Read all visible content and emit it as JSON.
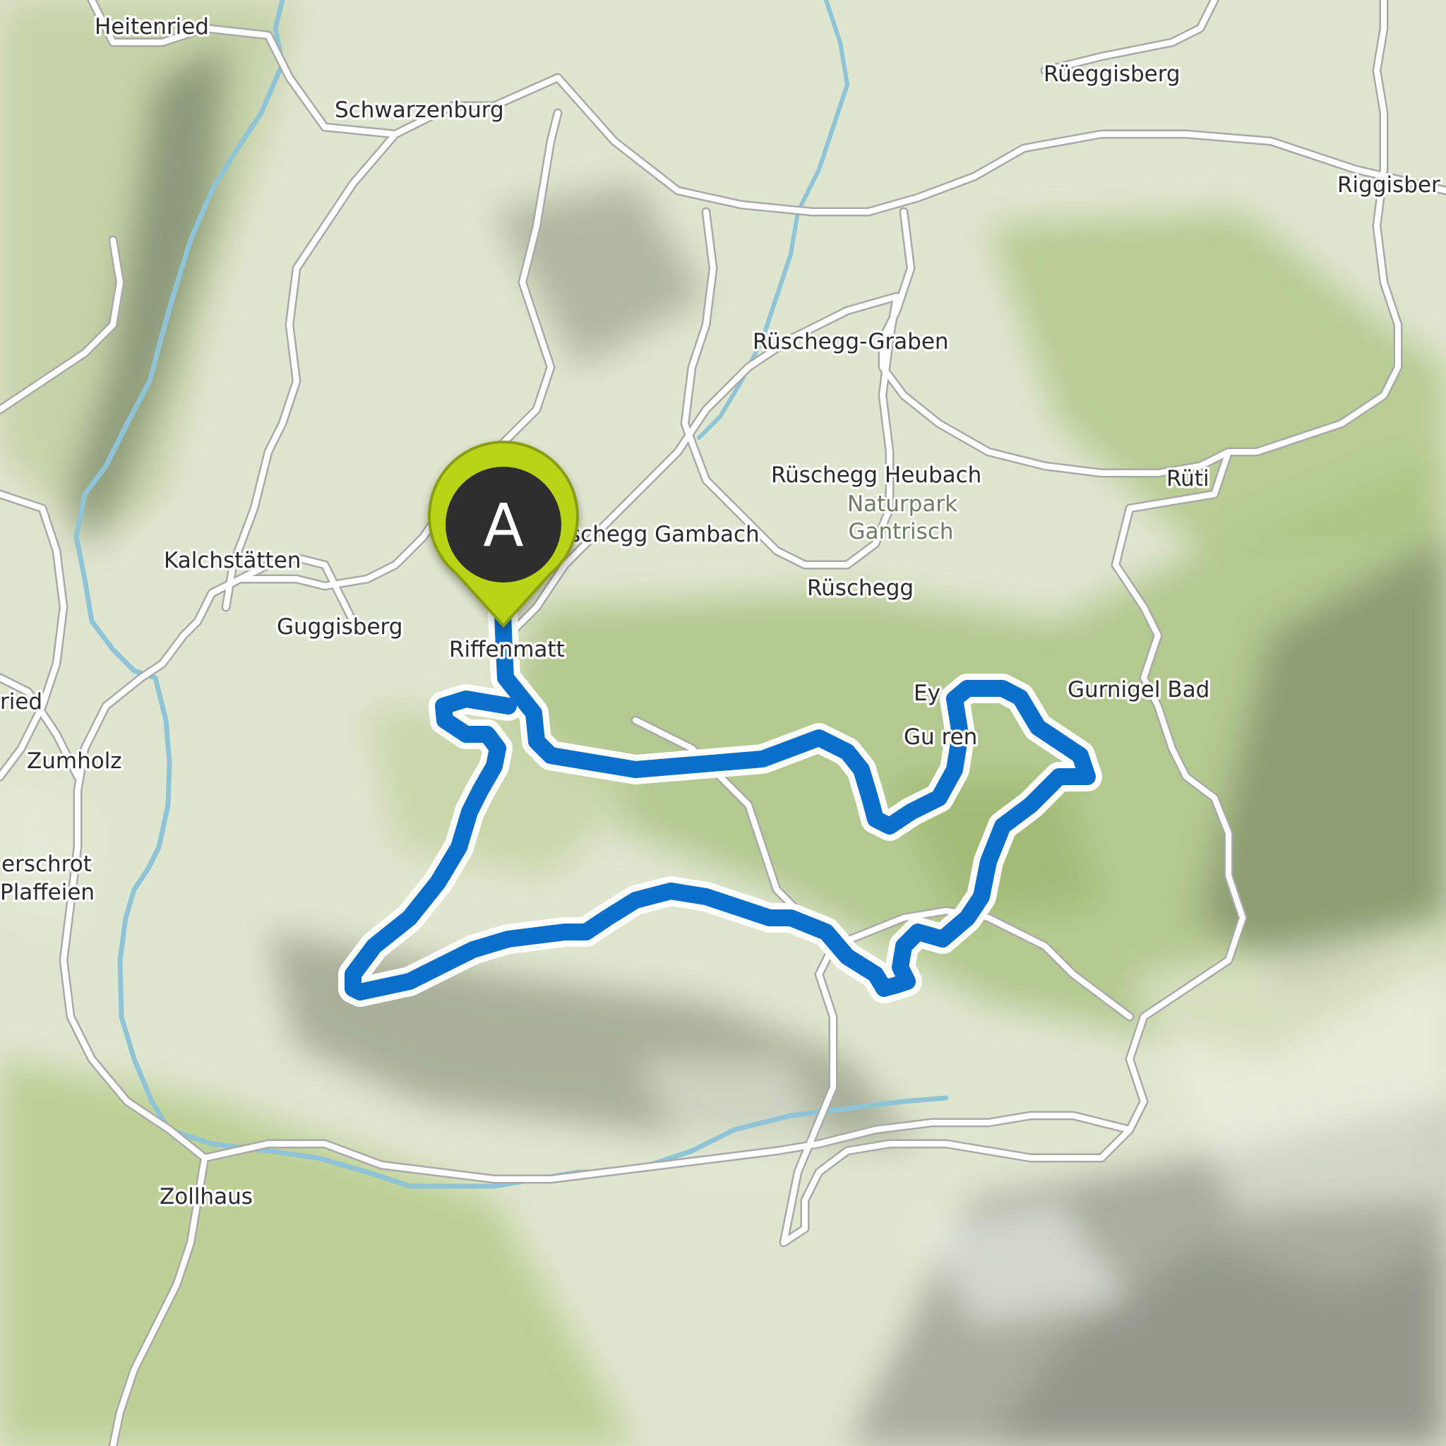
{
  "map": {
    "style": "topographic hillshade",
    "colors": {
      "route": "#0a6fcb",
      "route_casing": "#ffffff",
      "marker_fill": "#b9d416",
      "marker_inner": "#2e2e2e",
      "road": "#ffffff",
      "road_casing": "#a9a9a9",
      "river": "#8fc3d6",
      "forest": "#a9c27f",
      "meadow": "#dde6c6"
    },
    "places": {
      "heitenried": "Heitenried",
      "schwarzenburg": "Schwarzenburg",
      "rueeggisberg": "Rüeggisberg",
      "riggisberg": "Riggisber",
      "rueschegg_graben": "Rüschegg-Graben",
      "rueschegg_heubach": "Rüschegg Heubach",
      "rueti": "Rüti",
      "rueschegg_gambach": "schegg Gambach",
      "kalchstaetten": "Kalchstätten",
      "rueschegg": "Rüschegg",
      "guggisberg": "Guggisberg",
      "riffenmatt": "Riffenmatt",
      "gurnigel_bad": "Gurnigel Bad",
      "eywald": "Ey",
      "gurnigel_fragment": "Gu     ren",
      "ried": "ried",
      "zumholz": "Zumholz",
      "oberschrot": "erschrot",
      "plaffeien": "Plaffeien",
      "zollhaus": "Zollhaus"
    },
    "park_label": {
      "line1": "Naturpark",
      "line2": "Gantrisch"
    },
    "start_marker": {
      "letter": "A",
      "icon": "map-pin-icon"
    }
  }
}
